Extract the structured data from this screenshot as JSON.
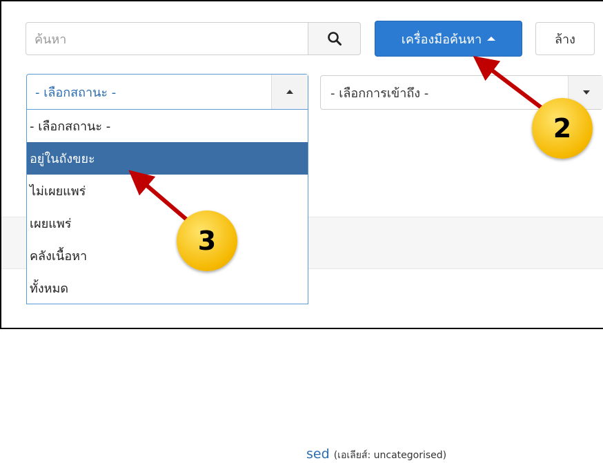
{
  "search": {
    "placeholder": "ค้นหา"
  },
  "toolbar": {
    "search_tools_label": "เครื่องมือค้นหา",
    "clear_label": "ล้าง"
  },
  "filters": {
    "status_selected": "- เลือกสถานะ -",
    "access_selected": "- เลือกการเข้าถึง -"
  },
  "status_options": [
    "- เลือกสถานะ -",
    "อยู่ในถังขยะ",
    "ไม่เผยแพร่",
    "เผยแพร่",
    "คลังเนื้อหา",
    "ทั้งหมด"
  ],
  "status_highlighted_index": 1,
  "category_row": {
    "link_text": "sed",
    "alias_text": "(เอเลียส์: uncategorised)"
  },
  "callouts": {
    "step2": "2",
    "step3": "3"
  },
  "colors": {
    "primary_button": "#2b7bd3",
    "highlight": "#3a6ea5",
    "arrow": "#c00000",
    "callout": "#f5b800"
  }
}
